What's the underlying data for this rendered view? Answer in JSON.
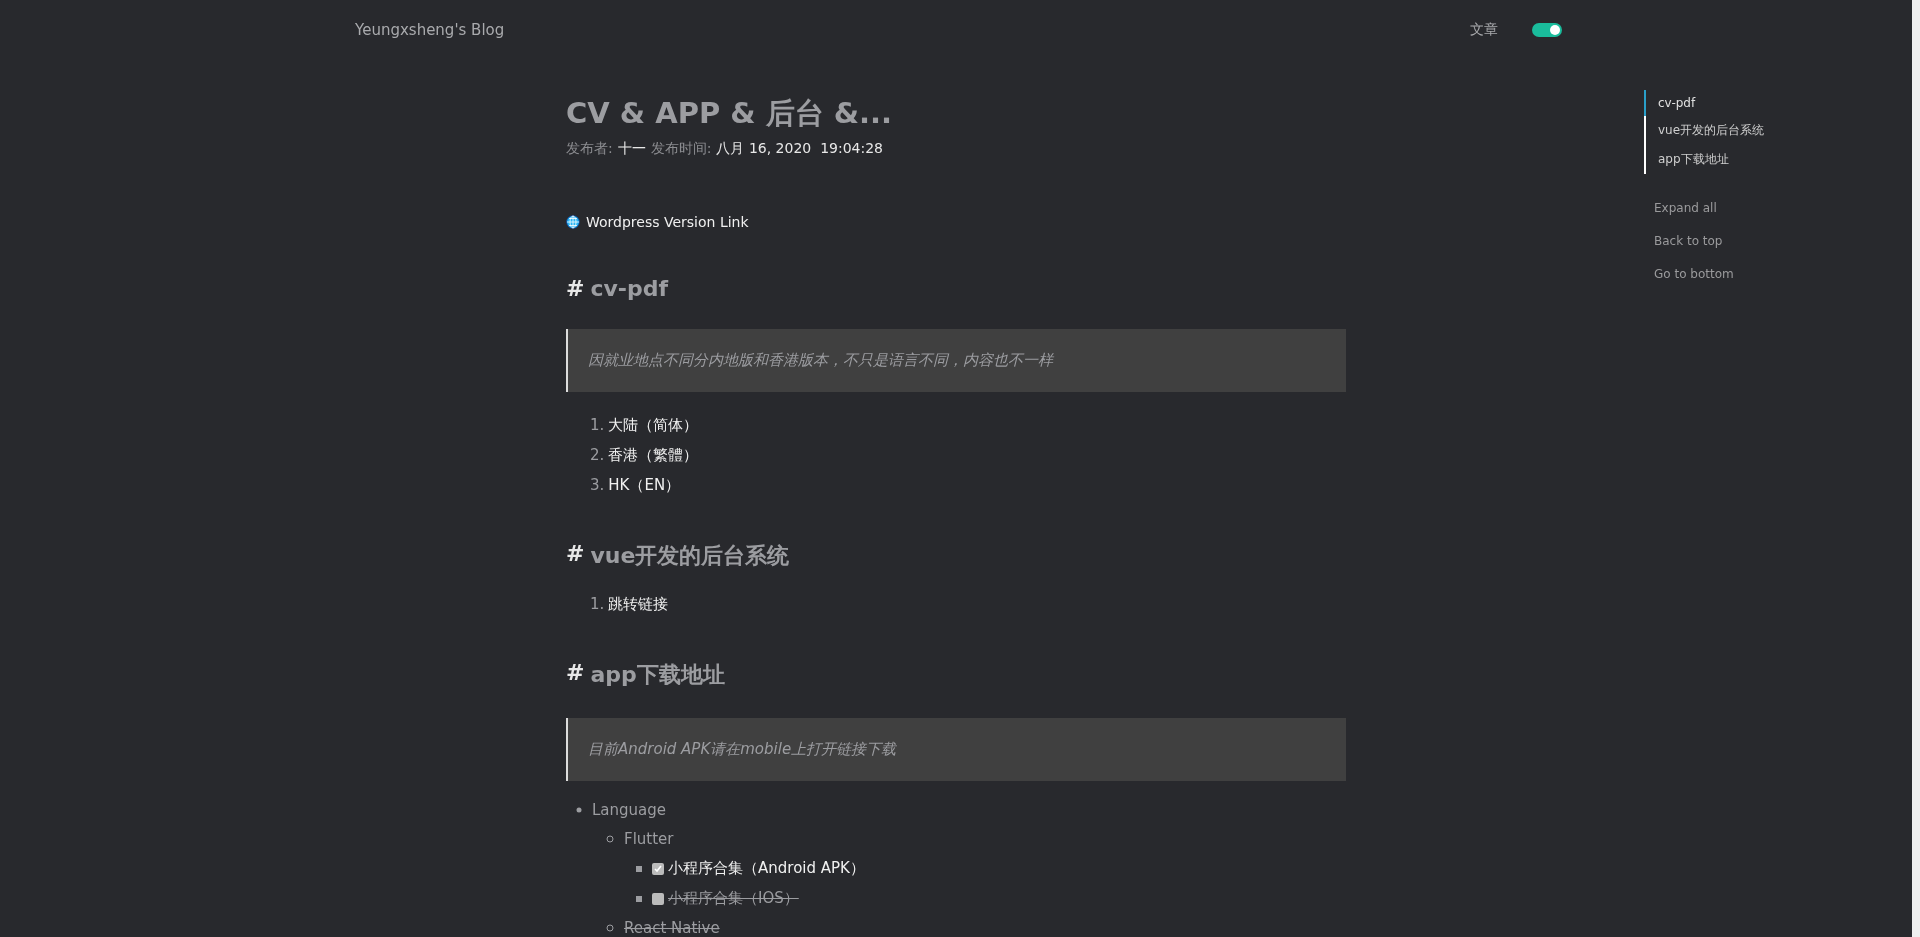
{
  "header": {
    "blog_title": "Yeungxsheng's Blog",
    "nav_link": "文章",
    "theme_toggle": {
      "on": true
    }
  },
  "post": {
    "title": "CV & APP & 后台 &...",
    "meta": [
      {
        "kind": "label",
        "text": "发布者:"
      },
      {
        "kind": "value",
        "text": "十一"
      },
      {
        "kind": "label",
        "text": "发布时间:"
      },
      {
        "kind": "value",
        "text": "八月 16, 2020  19:04:28"
      }
    ],
    "link": "Wordpress Version Link",
    "sections": [
      {
        "hash": "#",
        "heading": "cv-pdf",
        "quote": "因就业地点不同分内地版和香港版本，不只是语言不同，内容也不一样",
        "ordered": [
          {
            "num": "1.",
            "text": "大陆（简体）"
          },
          {
            "num": "2.",
            "text": "香港（繁體）"
          },
          {
            "num": "3.",
            "text": "HK（EN）"
          }
        ]
      },
      {
        "hash": "#",
        "heading": "vue开发的后台系统",
        "ordered": [
          {
            "num": "1.",
            "text": "跳转链接"
          }
        ]
      },
      {
        "hash": "#",
        "heading": "app下载地址",
        "quote": "目前Android APK请在mobile上打开链接下载",
        "bullets": [
          {
            "kind": "text",
            "text": "Language",
            "struck": false,
            "children": [
              {
                "kind": "text",
                "text": "Flutter",
                "struck": false,
                "children": [
                  {
                    "kind": "task",
                    "text": "小程序合集（Android APK）",
                    "checked": true,
                    "struck": false
                  },
                  {
                    "kind": "task",
                    "text": "小程序合集（IOS）",
                    "checked": false,
                    "struck": true
                  }
                ]
              },
              {
                "kind": "text",
                "text": "React Native",
                "struck": true
              }
            ]
          }
        ]
      }
    ]
  },
  "toc": {
    "items": [
      {
        "label": "cv-pdf",
        "selected": true
      },
      {
        "label": "vue开发的后台系统",
        "selected": false
      },
      {
        "label": "app下载地址",
        "selected": false
      }
    ],
    "actions": [
      "Expand all",
      "Back to top",
      "Go to bottom"
    ]
  }
}
